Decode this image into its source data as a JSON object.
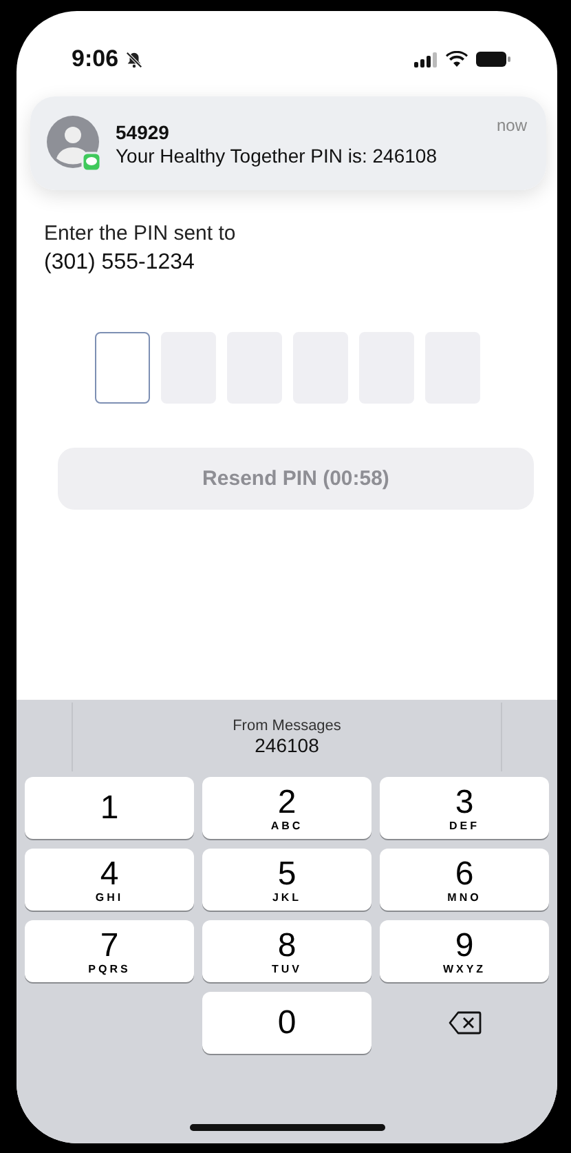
{
  "status_bar": {
    "time": "9:06",
    "silenced": true
  },
  "notification": {
    "sender": "54929",
    "message": "Your Healthy Together PIN is: 246108",
    "time": "now"
  },
  "prompt": {
    "label": "Enter the PIN sent to",
    "phone": "(301) 555-1234"
  },
  "pin_boxes": [
    {
      "selected": true
    },
    {
      "selected": false
    },
    {
      "selected": false
    },
    {
      "selected": false
    },
    {
      "selected": false
    },
    {
      "selected": false
    }
  ],
  "resend_button": {
    "label": "Resend PIN (00:58)",
    "disabled": true
  },
  "keyboard": {
    "suggestion": {
      "source": "From Messages",
      "code": "246108"
    },
    "keys": [
      {
        "kind": "digit",
        "digit": "1"
      },
      {
        "kind": "digit",
        "digit": "2",
        "letters": "ABC"
      },
      {
        "kind": "digit",
        "digit": "3",
        "letters": "DEF"
      },
      {
        "kind": "digit",
        "digit": "4",
        "letters": "GHI"
      },
      {
        "kind": "digit",
        "digit": "5",
        "letters": "JKL"
      },
      {
        "kind": "digit",
        "digit": "6",
        "letters": "MNO"
      },
      {
        "kind": "digit",
        "digit": "7",
        "letters": "PQRS"
      },
      {
        "kind": "digit",
        "digit": "8",
        "letters": "TUV"
      },
      {
        "kind": "digit",
        "digit": "9",
        "letters": "WXYZ"
      },
      {
        "kind": "blank"
      },
      {
        "kind": "digit",
        "digit": "0"
      },
      {
        "kind": "delete"
      }
    ]
  }
}
